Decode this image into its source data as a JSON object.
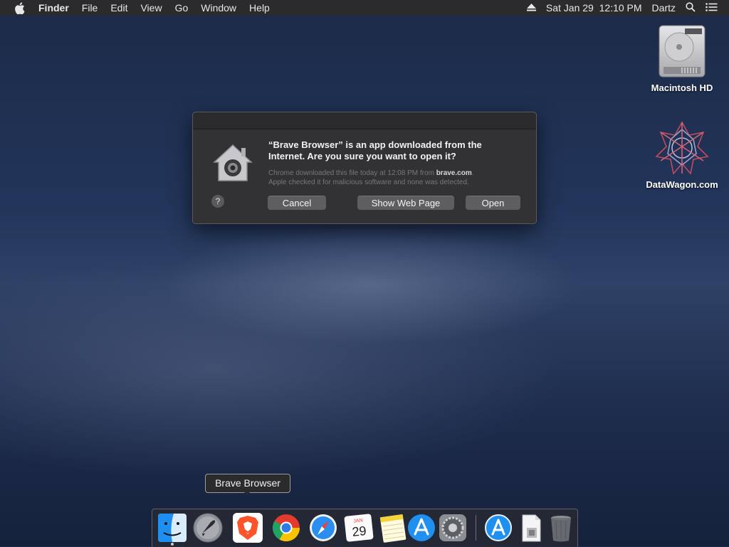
{
  "menubar": {
    "app_name": "Finder",
    "menus": [
      "File",
      "Edit",
      "View",
      "Go",
      "Window",
      "Help"
    ],
    "datetime": "Sat Jan 29  12:10 PM",
    "user": "Dartz"
  },
  "desktop": {
    "icons": [
      {
        "label": "Macintosh HD"
      },
      {
        "label": "DataWagon.com"
      }
    ]
  },
  "dialog": {
    "title": "“Brave Browser” is an app downloaded from the Internet. Are you sure you want to open it?",
    "info_prefix": "Chrome downloaded this file today at 12:08 PM from ",
    "info_source": "brave.com",
    "info_suffix": ".",
    "info_line2": "Apple checked it for malicious software and none was detected.",
    "help_label": "?",
    "buttons": {
      "cancel": "Cancel",
      "show_web_page": "Show Web Page",
      "open": "Open"
    }
  },
  "tooltip": "Brave Browser",
  "dock": {
    "calendar_month": "JAN",
    "calendar_day": "29",
    "items": [
      "finder-icon",
      "launchpad-icon",
      "brave-icon",
      "chrome-icon",
      "safari-icon",
      "calendar-icon",
      "notes-icon",
      "app-store-icon",
      "system-preferences-icon",
      "downloads-icon",
      "document-icon",
      "trash-icon"
    ]
  },
  "colors": {
    "menubar_bg": "#2b2b2d",
    "dialog_bg": "#323234",
    "button_bg": "#5e5e61",
    "brave_orange": "#fb542b"
  }
}
